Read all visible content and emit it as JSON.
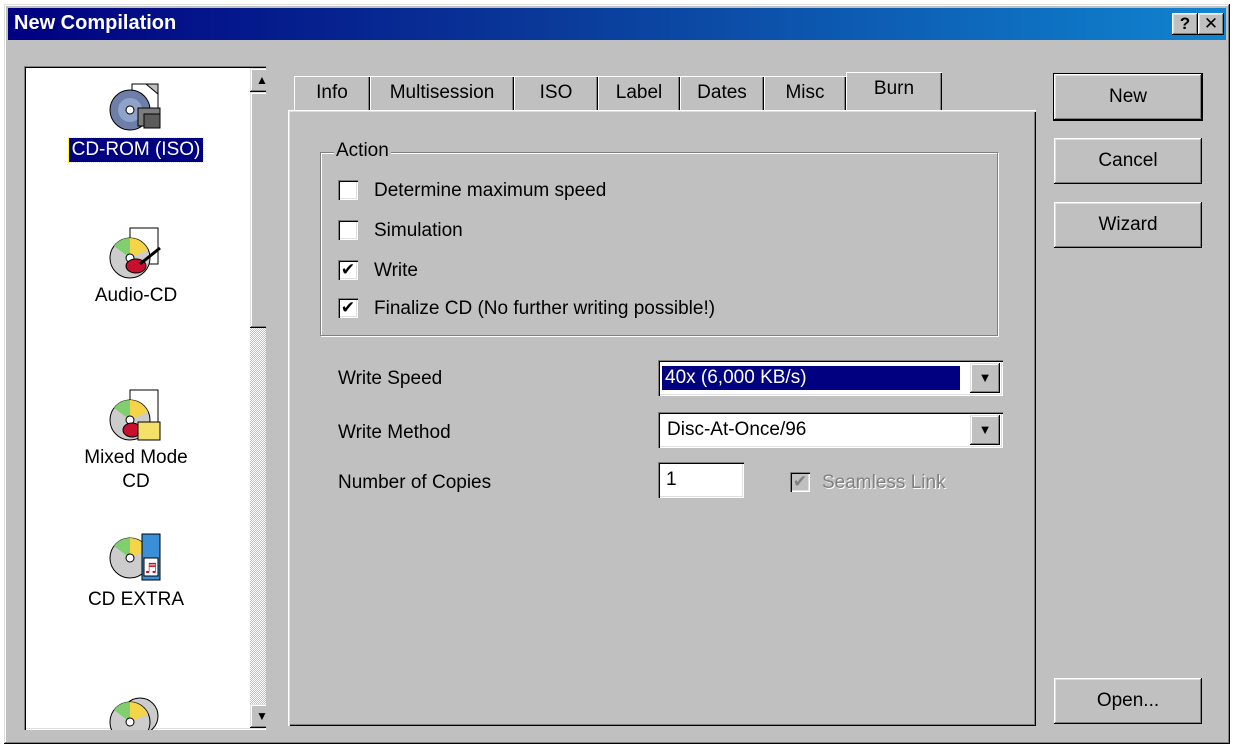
{
  "window": {
    "title": "New Compilation",
    "help_glyph": "?",
    "close_glyph": "✕"
  },
  "compilation_types": [
    {
      "label": "CD-ROM (ISO)",
      "icon": "cd-rom-iso-icon",
      "selected": true
    },
    {
      "label": "Audio-CD",
      "icon": "audio-cd-icon",
      "selected": false
    },
    {
      "label": "Mixed Mode CD",
      "label_line1": "Mixed Mode",
      "label_line2": "CD",
      "icon": "mixed-mode-cd-icon",
      "selected": false
    },
    {
      "label": "CD EXTRA",
      "icon": "cd-extra-icon",
      "selected": false
    },
    {
      "label": "",
      "icon": "cd-copy-icon",
      "selected": false
    }
  ],
  "tabs": [
    {
      "label": "Info",
      "active": false
    },
    {
      "label": "Multisession",
      "active": false
    },
    {
      "label": "ISO",
      "active": false
    },
    {
      "label": "Label",
      "active": false
    },
    {
      "label": "Dates",
      "active": false
    },
    {
      "label": "Misc",
      "active": false
    },
    {
      "label": "Burn",
      "active": true
    }
  ],
  "burn": {
    "action_group_title": "Action",
    "actions": [
      {
        "label": "Determine maximum speed",
        "checked": false
      },
      {
        "label": "Simulation",
        "checked": false
      },
      {
        "label": "Write",
        "checked": true
      },
      {
        "label": "Finalize CD (No further writing possible!)",
        "checked": true
      }
    ],
    "write_speed_label": "Write Speed",
    "write_speed_value": "40x (6,000 KB/s)",
    "write_method_label": "Write Method",
    "write_method_value": "Disc-At-Once/96",
    "copies_label": "Number of Copies",
    "copies_value": "1",
    "seamless_link_label": "Seamless Link",
    "seamless_link_checked": true,
    "seamless_link_enabled": false
  },
  "buttons": {
    "new": "New",
    "cancel": "Cancel",
    "wizard": "Wizard",
    "open": "Open..."
  },
  "glyphs": {
    "check": "✔",
    "arrow_up": "▲",
    "arrow_down": "▼"
  },
  "colors": {
    "title_bar": "#000080",
    "face": "#c0c0c0",
    "selection": "#000080"
  }
}
